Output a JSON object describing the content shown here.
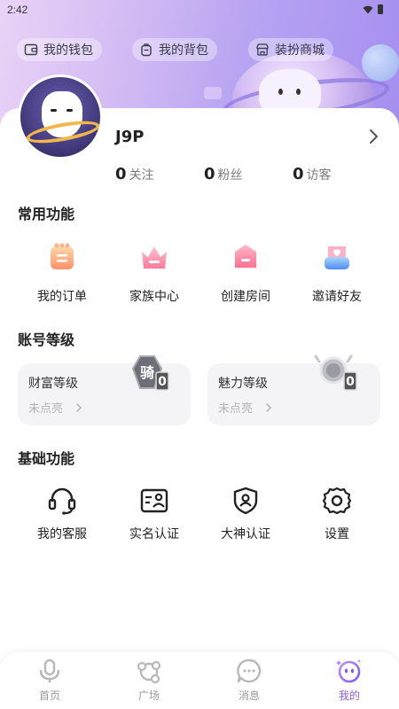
{
  "status_bar": {
    "time": "2:42"
  },
  "top_tabs": [
    {
      "label": "我的钱包",
      "icon": "wallet-icon"
    },
    {
      "label": "我的背包",
      "icon": "backpack-icon"
    },
    {
      "label": "装扮商城",
      "icon": "shop-icon"
    }
  ],
  "profile": {
    "username": "J9P",
    "stats": [
      {
        "value": "0",
        "label": "关注"
      },
      {
        "value": "0",
        "label": "粉丝"
      },
      {
        "value": "0",
        "label": "访客"
      }
    ]
  },
  "common_functions": {
    "title": "常用功能",
    "items": [
      {
        "label": "我的订单",
        "icon": "order-icon"
      },
      {
        "label": "家族中心",
        "icon": "family-center-icon"
      },
      {
        "label": "创建房间",
        "icon": "create-room-icon"
      },
      {
        "label": "邀请好友",
        "icon": "invite-friend-icon"
      }
    ]
  },
  "account_level": {
    "title": "账号等级",
    "cards": [
      {
        "title": "财富等级",
        "status": "未点亮",
        "badge_text": "骑",
        "badge_level": "0"
      },
      {
        "title": "魅力等级",
        "status": "未点亮",
        "badge_text": "",
        "badge_level": "0"
      }
    ]
  },
  "basic_functions": {
    "title": "基础功能",
    "items": [
      {
        "label": "我的客服",
        "icon": "headset-icon"
      },
      {
        "label": "实名认证",
        "icon": "id-card-icon"
      },
      {
        "label": "大神认证",
        "icon": "shield-user-icon"
      },
      {
        "label": "设置",
        "icon": "gear-icon"
      }
    ]
  },
  "bottom_nav": {
    "items": [
      {
        "label": "首页",
        "icon": "home-mic-icon"
      },
      {
        "label": "广场",
        "icon": "plaza-icon"
      },
      {
        "label": "消息",
        "icon": "message-icon"
      },
      {
        "label": "我的",
        "icon": "me-face-icon",
        "active": true
      }
    ]
  },
  "colors": {
    "accent": "#8b5cf6",
    "header_start": "#ead3f6",
    "header_end": "#a58ef0"
  }
}
